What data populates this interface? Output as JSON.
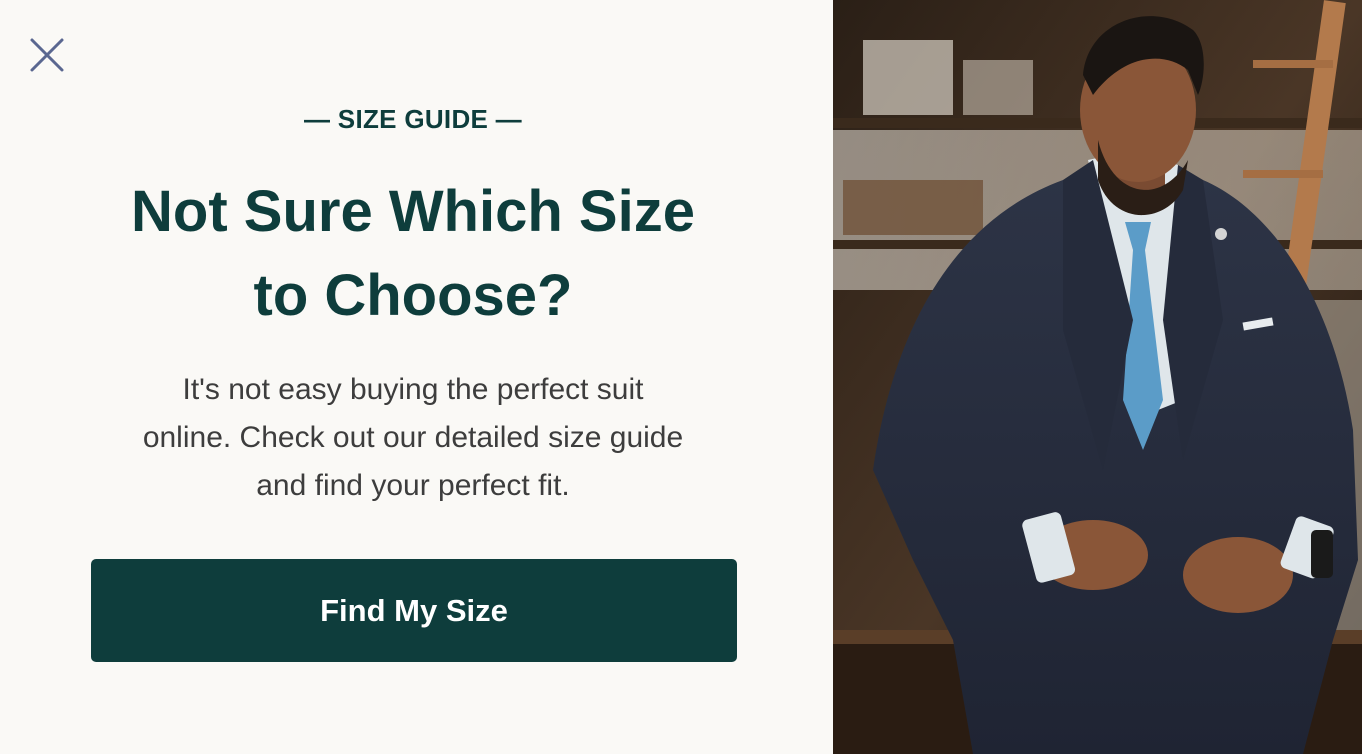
{
  "modal": {
    "eyebrow": "— SIZE GUIDE —",
    "headline_line1": "Not Sure Which Size",
    "headline_line2": "to Choose?",
    "body_line1": "It's not easy buying the perfect suit",
    "body_line2": "online. Check out our detailed size guide",
    "body_line3": "and find your perfect fit.",
    "cta_label": "Find My Size",
    "close_icon": "close-icon"
  },
  "colors": {
    "background": "#faf9f6",
    "accent": "#0e3d3c",
    "body_text": "#3d3d3d",
    "close_icon": "#5a6790",
    "cta_text": "#ffffff"
  }
}
